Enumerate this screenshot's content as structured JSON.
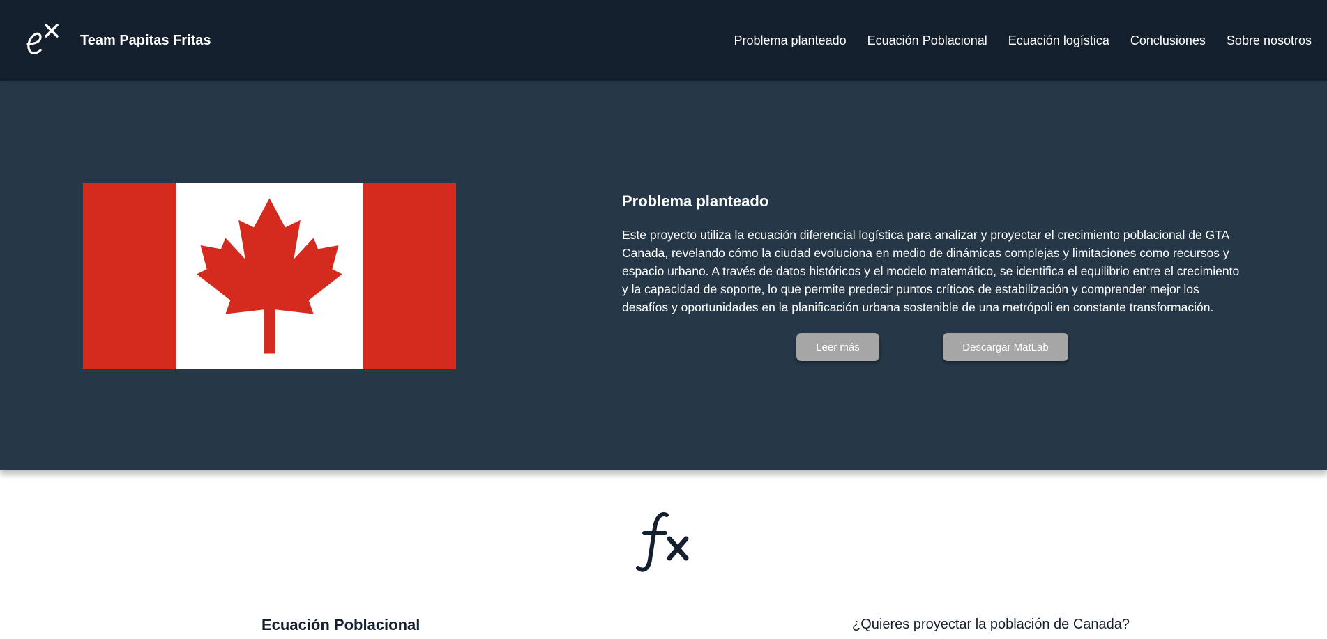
{
  "header": {
    "logo_icon": "exponential-ex-icon",
    "brand": "Team Papitas Fritas",
    "nav": [
      "Problema planteado",
      "Ecuación Poblacional",
      "Ecuación logística",
      "Conclusiones",
      "Sobre nosotros"
    ]
  },
  "hero": {
    "image": "canada-flag",
    "title": "Problema planteado",
    "text": "Este proyecto utiliza la ecuación diferencial logística para analizar y proyectar el crecimiento poblacional de GTA Canada, revelando cómo la ciudad evoluciona en medio de dinámicas complejas y limitaciones como recursos y espacio urbano. A través de datos históricos y el modelo matemático, se identifica el equilibrio entre el crecimiento y la capacidad de soporte, lo que permite predecir puntos críticos de estabilización y comprender mejor los desafíos y oportunidades en la planificación urbana sostenible de una metrópoli en constante transformación.",
    "read_more_label": "Leer más",
    "download_label": "Descargar MatLab"
  },
  "section": {
    "icon": "function-fx-icon",
    "title": "Ecuación Poblacional",
    "question": "¿Quieres proyectar la población de Canada?"
  },
  "colors": {
    "navbar": "#15202e",
    "hero": "#263747",
    "button": "#a6a6a6",
    "flag_red": "#d52b1e"
  }
}
